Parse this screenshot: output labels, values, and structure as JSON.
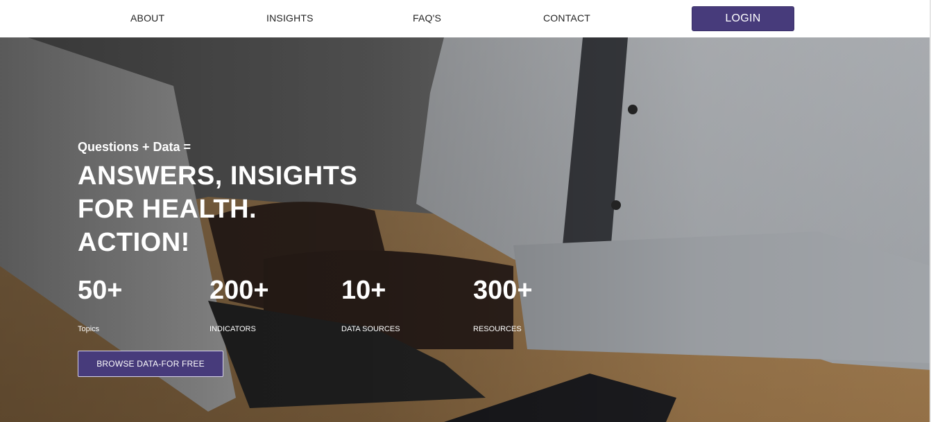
{
  "nav": {
    "links": [
      "ABOUT",
      "INSIGHTS",
      "FAQ'S",
      "CONTACT"
    ],
    "login_label": "LOGIN"
  },
  "hero": {
    "eyebrow": "Questions + Data =",
    "title_lines": [
      "ANSWERS, INSIGHTS",
      "FOR HEALTH.",
      "ACTION!"
    ],
    "stats": [
      {
        "value": "50+",
        "label": "Topics"
      },
      {
        "value": "200+",
        "label": "INDICATORS"
      },
      {
        "value": "10+",
        "label": "DATA SOURCES"
      },
      {
        "value": "300+",
        "label": "RESOURCES"
      }
    ],
    "cta_label": "BROWSE DATA-FOR FREE"
  },
  "colors": {
    "accent": "#473b7b",
    "nav_bg": "#ffffff",
    "hero_text": "#ffffff"
  }
}
